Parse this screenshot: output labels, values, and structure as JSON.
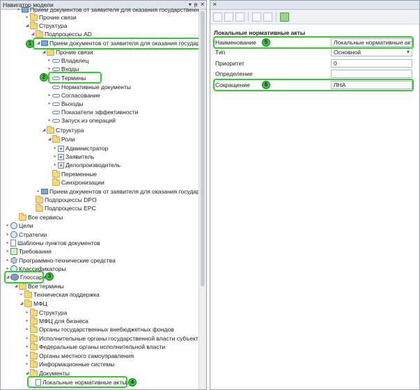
{
  "navigator": {
    "title": "Навигатор модели",
    "title_buttons": [
      "▾",
      "ᵽ",
      "✕"
    ],
    "tree": [
      {
        "label": "Прием документов от заявителя для оказания государственн"
      },
      {
        "label": "Прочие связи"
      },
      {
        "label": "Структура"
      },
      {
        "label": "Подпроцессы AD"
      },
      {
        "label": "Прием документов от заявителя для оказания государстве"
      },
      {
        "label": "Прочие связи"
      },
      {
        "label": "Владелец"
      },
      {
        "label": "Входы"
      },
      {
        "label": "Термины"
      },
      {
        "label": "Нормативные документы"
      },
      {
        "label": "Согласование"
      },
      {
        "label": "Выходы"
      },
      {
        "label": "Показатели эффективности"
      },
      {
        "label": "Запуск из операций"
      },
      {
        "label": "Структура"
      },
      {
        "label": "Роли"
      },
      {
        "label": "Администратор"
      },
      {
        "label": "Заявитель"
      },
      {
        "label": "Делопроизводитель"
      },
      {
        "label": "Переменные"
      },
      {
        "label": "Синхронизации"
      },
      {
        "label": "Прием документов от заявителя для оказания государстве"
      },
      {
        "label": "Подпроцессы DPO"
      },
      {
        "label": "Подпроцессы EPC"
      },
      {
        "label": "Все сервисы"
      },
      {
        "label": "Цели"
      },
      {
        "label": "Стратегии"
      },
      {
        "label": "Шаблоны пунктов документов"
      },
      {
        "label": "Требования"
      },
      {
        "label": "Программно-технические средства"
      },
      {
        "label": "Классификаторы"
      },
      {
        "label": "Глоссарий"
      },
      {
        "label": "Все термины"
      },
      {
        "label": "Техническая поддержка"
      },
      {
        "label": "МФЦ"
      },
      {
        "label": "Структура"
      },
      {
        "label": "МФЦ для бизнеса"
      },
      {
        "label": "Органы государственных внебюджетных фондов"
      },
      {
        "label": "Исполнительные органы государственной власти субъекта РФ"
      },
      {
        "label": "Федеральные органы исполнительной власти"
      },
      {
        "label": "Органы местного самоуправления"
      },
      {
        "label": "Информационные системы"
      },
      {
        "label": "Документы"
      },
      {
        "label": "Локальные нормативные акты"
      }
    ],
    "markers": [
      "1",
      "2",
      "3",
      "4"
    ]
  },
  "properties": {
    "title": "Локальные нормативные акты",
    "rows": [
      {
        "label": "Наименование",
        "value": "Локальные нормативные акты"
      },
      {
        "label": "Тип",
        "value": "Основной"
      },
      {
        "label": "Приоритет",
        "value": "0"
      },
      {
        "label": "Определение",
        "value": ""
      },
      {
        "label": "Сокращение",
        "value": "ЛНА"
      }
    ],
    "markers": [
      "5",
      "6"
    ]
  },
  "colors": {
    "highlight": "#37c83a",
    "folder": "#f6d77a",
    "panel_header": "#dfe5ec"
  }
}
